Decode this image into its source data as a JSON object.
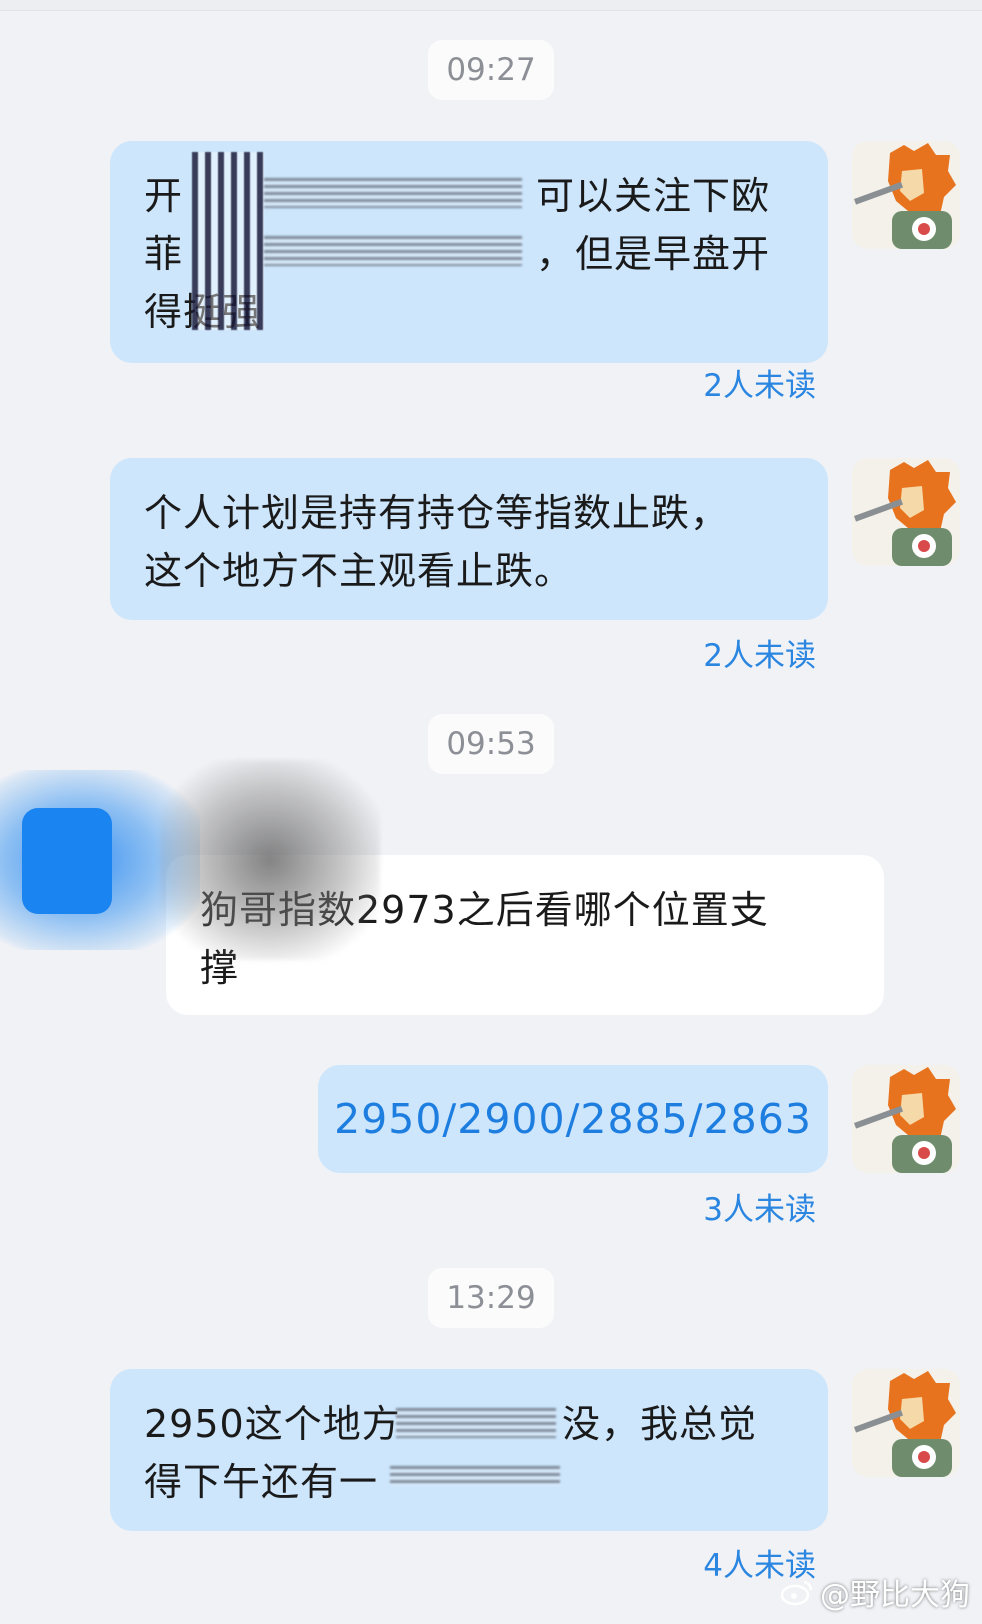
{
  "messages": [
    {
      "time": "09:27"
    },
    {
      "text_line1_start": "开",
      "text_line1_end": "可以关注下欧",
      "text_line2_start": "菲",
      "text_line2_end": "，但是早盘开",
      "text_line3": "得挺强",
      "unread": "2人未读"
    },
    {
      "text_line1": "个人计划是持有持仓等指数止跌，",
      "text_line2": "这个地方不主观看止跌。",
      "unread": "2人未读"
    },
    {
      "time": "09:53"
    },
    {
      "text_line1": "狗哥指数2973之后看哪个位置支",
      "text_line2": "撑"
    },
    {
      "text": "2950/2900/2885/2863",
      "unread": "3人未读"
    },
    {
      "time": "13:29"
    },
    {
      "text_line1_start": "2950这个地方",
      "text_line1_end": "没，我总觉",
      "text_line2_start": "得下午还有一",
      "unread": "4人未读"
    }
  ],
  "watermark": "@野比大狗",
  "colors": {
    "my_bubble": "#cde6fc",
    "their_bubble": "#ffffff",
    "unread": "#2a86e0",
    "background": "#f1f2f6"
  },
  "icons": {
    "avatar": "lion-cartoon-avatar",
    "weibo": "weibo-logo-icon"
  }
}
